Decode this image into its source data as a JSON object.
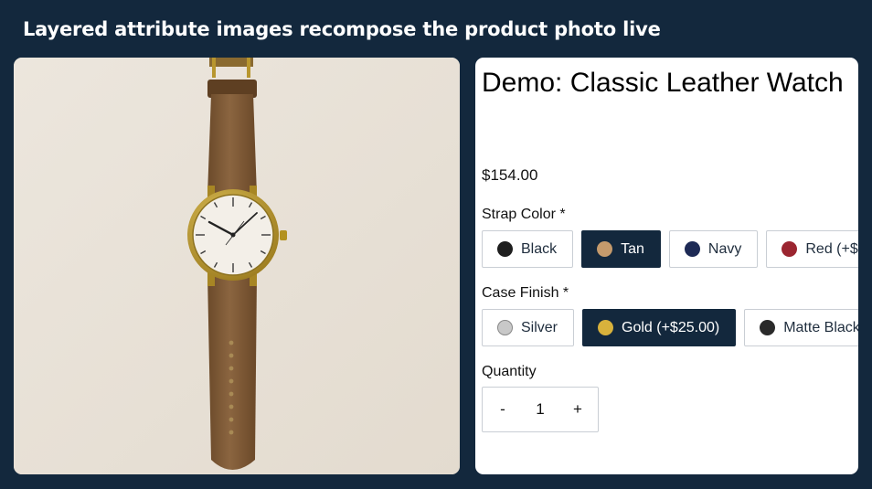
{
  "banner": {
    "title": "Layered attribute images recompose the product photo live"
  },
  "product": {
    "title": "Demo: Classic Leather Watch",
    "price": "$154.00"
  },
  "strap": {
    "label": "Strap Color *",
    "options": [
      {
        "label": "Black",
        "color": "#1e1e1e",
        "selected": false
      },
      {
        "label": "Tan",
        "color": "#c49a6c",
        "selected": true
      },
      {
        "label": "Navy",
        "color": "#1d2a55",
        "selected": false
      },
      {
        "label": "Red (+$",
        "color": "#9b2530",
        "selected": false
      }
    ]
  },
  "finish": {
    "label": "Case Finish *",
    "options": [
      {
        "label": "Silver",
        "color": "#c8c8c8",
        "selected": false
      },
      {
        "label": "Gold (+$25.00)",
        "color": "#d8b23c",
        "selected": true
      },
      {
        "label": "Matte Black",
        "color": "#2a2a2a",
        "selected": false
      }
    ]
  },
  "quantity": {
    "label": "Quantity",
    "minus": "-",
    "value": "1",
    "plus": "+"
  },
  "colors": {
    "background": "#13283d",
    "selected_bg": "#13283d",
    "panel": "#ffffff"
  }
}
